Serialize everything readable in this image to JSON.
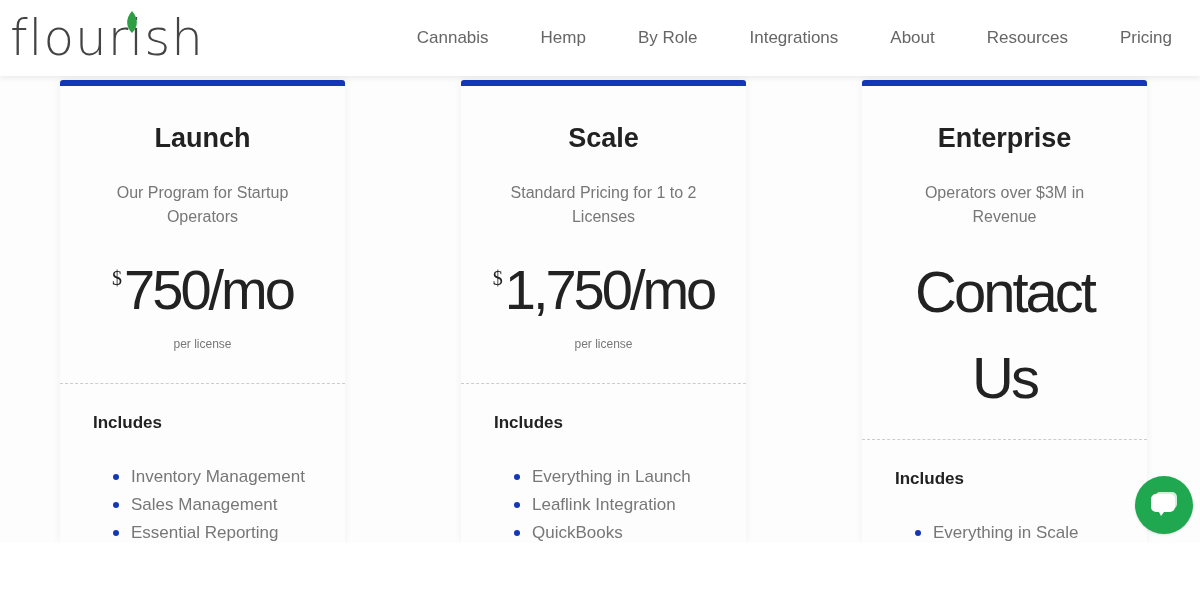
{
  "logo": {
    "text": "flourish"
  },
  "nav": [
    {
      "label": "Cannabis"
    },
    {
      "label": "Hemp"
    },
    {
      "label": "By Role"
    },
    {
      "label": "Integrations"
    },
    {
      "label": "About"
    },
    {
      "label": "Resources"
    },
    {
      "label": "Pricing"
    }
  ],
  "plans": [
    {
      "kind": "price",
      "name": "Launch",
      "subtitle": "Our Program for Startup Operators",
      "currency": "$",
      "amount": "750/mo",
      "note": "per license",
      "includes_title": "Includes",
      "features": [
        "Inventory Management",
        "Sales Management",
        "Essential Reporting"
      ]
    },
    {
      "kind": "price",
      "name": "Scale",
      "subtitle": "Standard Pricing for 1 to 2 Licenses",
      "currency": "$",
      "amount": "1,750/mo",
      "note": "per license",
      "includes_title": "Includes",
      "features": [
        "Everything in Launch",
        "Leaflink Integration",
        "QuickBooks"
      ]
    },
    {
      "kind": "contact",
      "name": "Enterprise",
      "subtitle": "Operators over $3M in Revenue",
      "amount": "Contact Us",
      "includes_title": "Includes",
      "features": [
        "Everything in Scale"
      ]
    }
  ]
}
